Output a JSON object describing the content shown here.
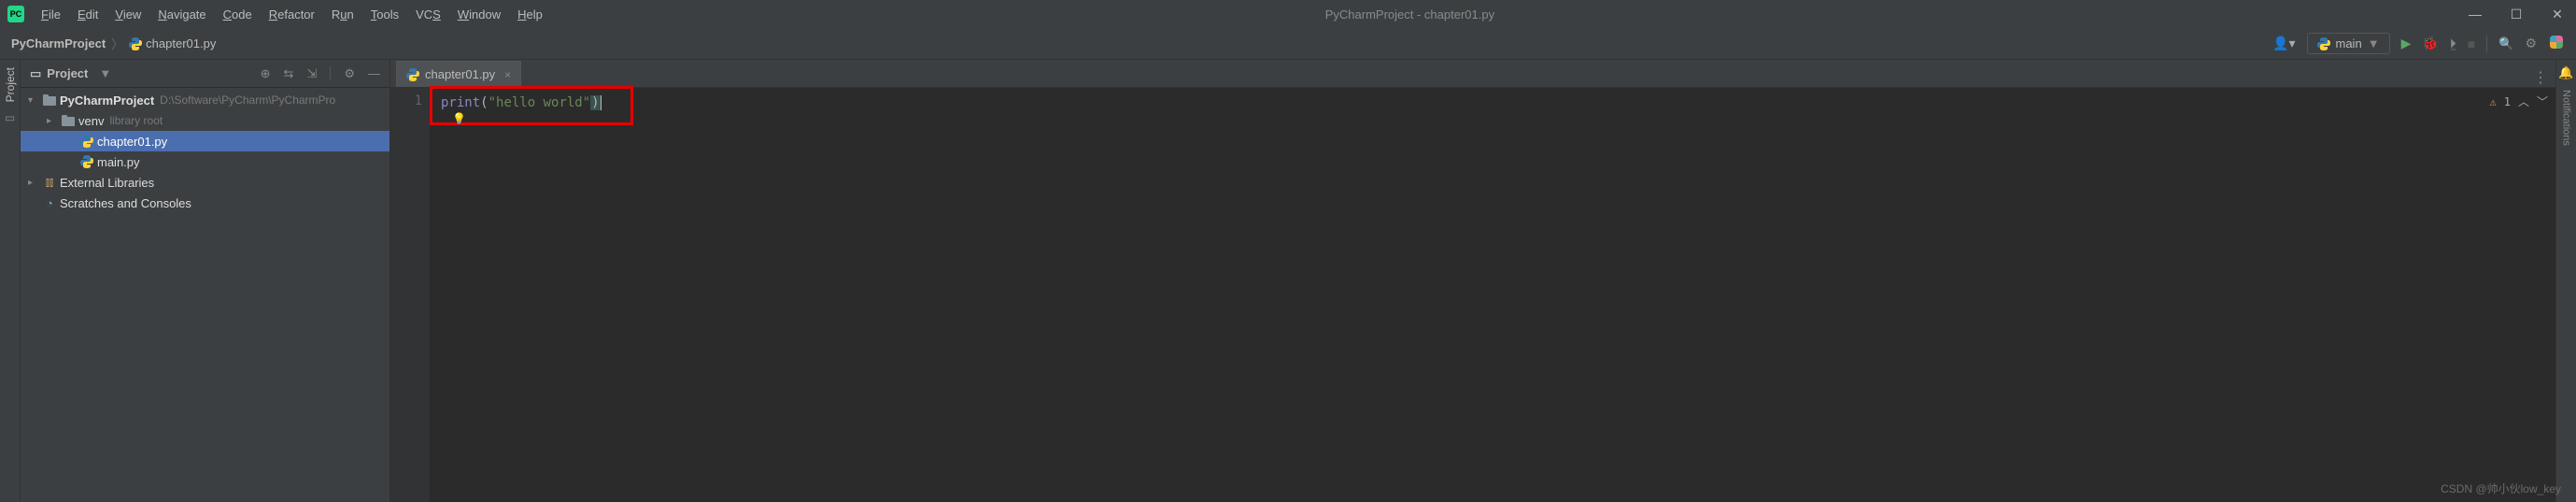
{
  "titlebar": {
    "app_badge": "PC",
    "menu": [
      "File",
      "Edit",
      "View",
      "Navigate",
      "Code",
      "Refactor",
      "Run",
      "Tools",
      "VCS",
      "Window",
      "Help"
    ],
    "title": "PyCharmProject - chapter01.py"
  },
  "navbar": {
    "breadcrumb_root": "PyCharmProject",
    "breadcrumb_file": "chapter01.py",
    "run_config": "main"
  },
  "project_panel": {
    "title": "Project",
    "tree": {
      "root": {
        "label": "PyCharmProject",
        "path": "D:\\Software\\PyCharm\\PyCharmPro"
      },
      "venv": {
        "label": "venv",
        "extra": "library root"
      },
      "file1": "chapter01.py",
      "file2": "main.py",
      "ext_lib": "External Libraries",
      "scratches": "Scratches and Consoles"
    }
  },
  "editor": {
    "tab_label": "chapter01.py",
    "line_no": "1",
    "code_kw": "print",
    "code_str": "\"hello world\"",
    "warnings": "1"
  },
  "sidebars": {
    "left_label": "Project",
    "right_label": "Notifications"
  },
  "watermark": "CSDN @帅小伙low_key"
}
